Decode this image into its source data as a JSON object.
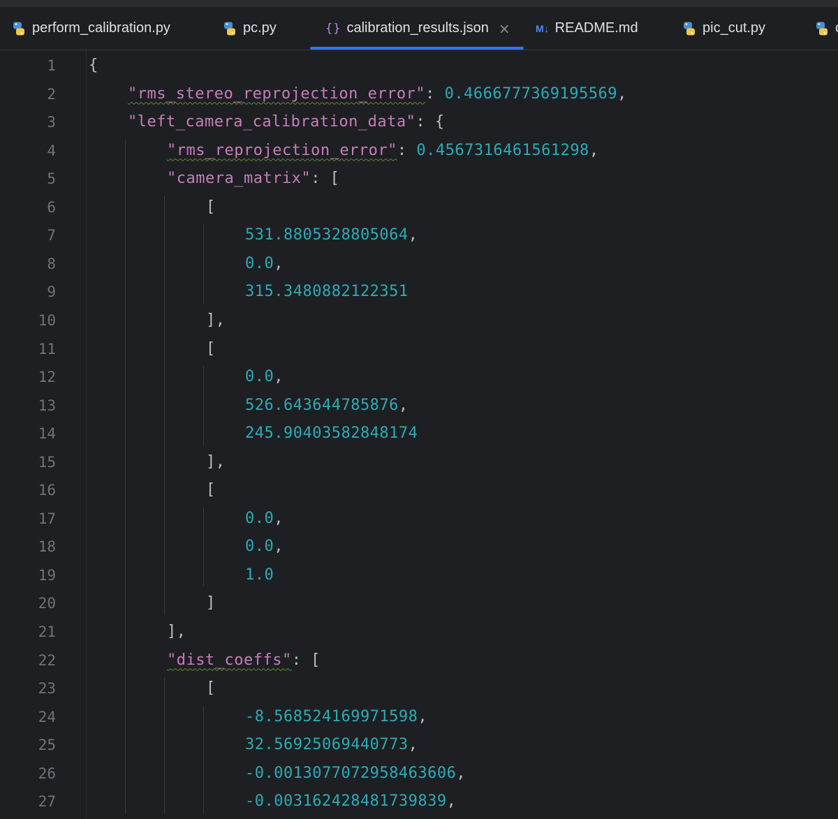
{
  "tabs": [
    {
      "label": "perform_calibration.py",
      "icon": "python-icon",
      "active": false
    },
    {
      "label": "pc.py",
      "icon": "python-icon",
      "active": false
    },
    {
      "label": "calibration_results.json",
      "icon": "json-icon",
      "icon_text": "{}",
      "active": true,
      "close": "×"
    },
    {
      "label": "README.md",
      "icon": "markdown-icon",
      "icon_text": "M↓",
      "active": false
    },
    {
      "label": "pic_cut.py",
      "icon": "python-icon",
      "active": false
    },
    {
      "label": "c",
      "icon": "python-icon",
      "active": false
    }
  ],
  "colors": {
    "background": "#1e1f22",
    "key": "#c77dbb",
    "number": "#2aacb8",
    "punctuation": "#bcbec4",
    "line_number": "#6f737a",
    "active_tab_underline": "#3574f0",
    "typo_squiggle": "#5f8c3a"
  },
  "editor": {
    "lines": [
      {
        "n": "1",
        "tokens": [
          {
            "t": "{",
            "c": "punc"
          }
        ]
      },
      {
        "n": "2",
        "tokens": [
          {
            "t": "\"rms_stereo_reprojection_error\"",
            "c": "key",
            "sq": true
          },
          {
            "t": ": ",
            "c": "punc"
          },
          {
            "t": "0.4666777369195569",
            "c": "num"
          },
          {
            "t": ",",
            "c": "punc"
          }
        ]
      },
      {
        "n": "3",
        "tokens": [
          {
            "t": "\"left_camera_calibration_data\"",
            "c": "key"
          },
          {
            "t": ": {",
            "c": "punc"
          }
        ]
      },
      {
        "n": "4",
        "tokens": [
          {
            "t": "\"rms_reprojection_error\"",
            "c": "key",
            "sq": true
          },
          {
            "t": ": ",
            "c": "punc"
          },
          {
            "t": "0.4567316461561298",
            "c": "num"
          },
          {
            "t": ",",
            "c": "punc"
          }
        ]
      },
      {
        "n": "5",
        "tokens": [
          {
            "t": "\"camera_matrix\"",
            "c": "key"
          },
          {
            "t": ": [",
            "c": "punc"
          }
        ]
      },
      {
        "n": "6",
        "tokens": [
          {
            "t": "[",
            "c": "punc"
          }
        ]
      },
      {
        "n": "7",
        "tokens": [
          {
            "t": "531.8805328805064",
            "c": "num"
          },
          {
            "t": ",",
            "c": "punc"
          }
        ]
      },
      {
        "n": "8",
        "tokens": [
          {
            "t": "0.0",
            "c": "num"
          },
          {
            "t": ",",
            "c": "punc"
          }
        ]
      },
      {
        "n": "9",
        "tokens": [
          {
            "t": "315.3480882122351",
            "c": "num"
          }
        ]
      },
      {
        "n": "10",
        "tokens": [
          {
            "t": "],",
            "c": "punc"
          }
        ]
      },
      {
        "n": "11",
        "tokens": [
          {
            "t": "[",
            "c": "punc"
          }
        ]
      },
      {
        "n": "12",
        "tokens": [
          {
            "t": "0.0",
            "c": "num"
          },
          {
            "t": ",",
            "c": "punc"
          }
        ]
      },
      {
        "n": "13",
        "tokens": [
          {
            "t": "526.643644785876",
            "c": "num"
          },
          {
            "t": ",",
            "c": "punc"
          }
        ]
      },
      {
        "n": "14",
        "tokens": [
          {
            "t": "245.90403582848174",
            "c": "num"
          }
        ]
      },
      {
        "n": "15",
        "tokens": [
          {
            "t": "],",
            "c": "punc"
          }
        ]
      },
      {
        "n": "16",
        "tokens": [
          {
            "t": "[",
            "c": "punc"
          }
        ]
      },
      {
        "n": "17",
        "tokens": [
          {
            "t": "0.0",
            "c": "num"
          },
          {
            "t": ",",
            "c": "punc"
          }
        ]
      },
      {
        "n": "18",
        "tokens": [
          {
            "t": "0.0",
            "c": "num"
          },
          {
            "t": ",",
            "c": "punc"
          }
        ]
      },
      {
        "n": "19",
        "tokens": [
          {
            "t": "1.0",
            "c": "num"
          }
        ]
      },
      {
        "n": "20",
        "tokens": [
          {
            "t": "]",
            "c": "punc"
          }
        ]
      },
      {
        "n": "21",
        "tokens": [
          {
            "t": "],",
            "c": "punc"
          }
        ]
      },
      {
        "n": "22",
        "tokens": [
          {
            "t": "\"dist_coeffs\"",
            "c": "key",
            "sq": true
          },
          {
            "t": ": [",
            "c": "punc"
          }
        ]
      },
      {
        "n": "23",
        "tokens": [
          {
            "t": "[",
            "c": "punc"
          }
        ]
      },
      {
        "n": "24",
        "tokens": [
          {
            "t": "-8.568524169971598",
            "c": "num"
          },
          {
            "t": ",",
            "c": "punc"
          }
        ]
      },
      {
        "n": "25",
        "tokens": [
          {
            "t": "32.56925069440773",
            "c": "num"
          },
          {
            "t": ",",
            "c": "punc"
          }
        ]
      },
      {
        "n": "26",
        "tokens": [
          {
            "t": "-0.0013077072958463606",
            "c": "num"
          },
          {
            "t": ",",
            "c": "punc"
          }
        ]
      },
      {
        "n": "27",
        "tokens": [
          {
            "t": "-0.003162428481739839",
            "c": "num"
          },
          {
            "t": ",",
            "c": "punc"
          }
        ]
      }
    ]
  }
}
